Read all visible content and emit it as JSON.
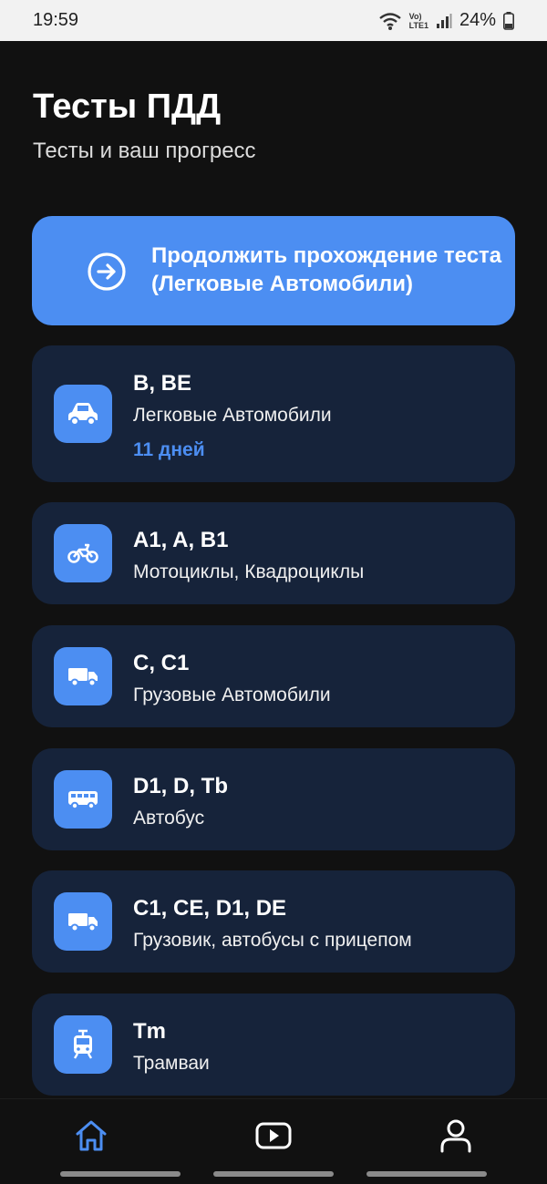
{
  "status_bar": {
    "time": "19:59",
    "network_label_top": "Vo)",
    "network_label_bottom": "LTE1",
    "battery": "24%"
  },
  "header": {
    "title": "Тесты ПДД",
    "subtitle": "Тесты и ваш прогресс"
  },
  "continue": {
    "label": "Продолжить прохождение теста (Легковые Автомобили)",
    "icon": "arrow-right-circle-icon"
  },
  "categories": [
    {
      "code": "B, BE",
      "desc": "Легковые Автомобили",
      "days": "11 дней",
      "icon": "car-icon"
    },
    {
      "code": "A1, A, B1",
      "desc": "Мотоциклы, Квадроциклы",
      "icon": "motorcycle-icon"
    },
    {
      "code": "C, C1",
      "desc": "Грузовые Автомобили",
      "icon": "truck-icon"
    },
    {
      "code": "D1, D, Tb",
      "desc": "Автобус",
      "icon": "bus-icon"
    },
    {
      "code": "C1, CE, D1, DE",
      "desc": "Грузовик, автобусы с прицепом",
      "icon": "truck-trailer-icon"
    },
    {
      "code": "Tm",
      "desc": "Трамваи",
      "icon": "tram-icon"
    }
  ],
  "nav": {
    "items": [
      "home-icon",
      "video-icon",
      "profile-icon"
    ],
    "active": "home-icon"
  },
  "colors": {
    "accent": "#4c8ef2",
    "card_bg": "#16233a",
    "page_bg": "#111111"
  }
}
